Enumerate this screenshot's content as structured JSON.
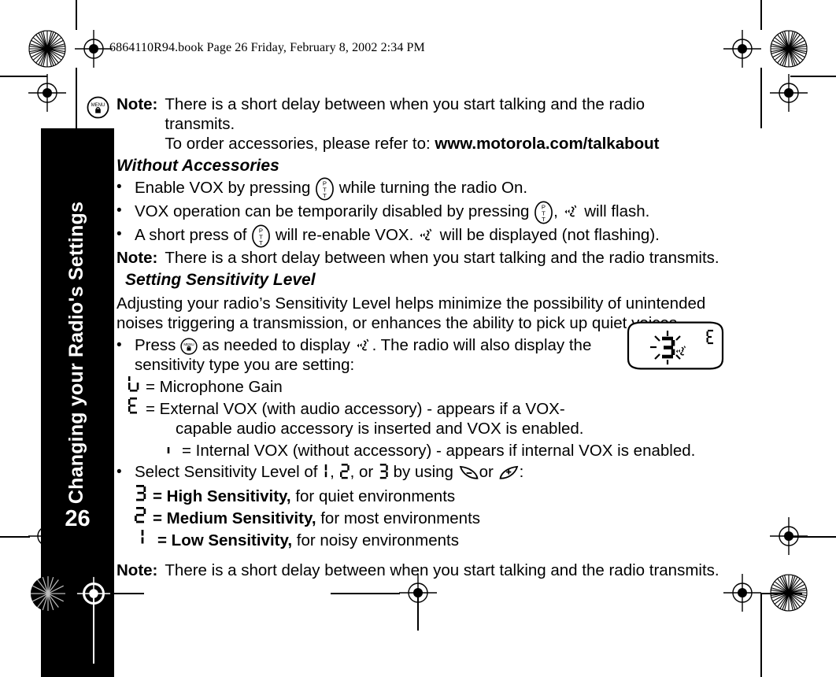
{
  "header": {
    "text": "6864110R94.book  Page 26  Friday, February 8, 2002  2:34 PM"
  },
  "sidebar": {
    "chapter_title": "Changing your Radio's Settings",
    "page_number": "26"
  },
  "content": {
    "note1": {
      "label": "Note:",
      "line1": "There is a short delay between when you start talking and the radio",
      "line2": "transmits.",
      "line3_prefix": "To order accessories, please refer to: ",
      "line3_url": "www.motorola.com/talkabout"
    },
    "heading_without_accessories": "Without Accessories",
    "bullets_without_accessories": [
      {
        "pre": "Enable VOX by pressing ",
        "icon": "ptt-icon",
        "post": " while turning the radio On."
      },
      {
        "pre": "VOX operation can be temporarily disabled by pressing ",
        "icon": "ptt-icon",
        "mid": ", ",
        "icon2": "vox-icon",
        "post": " will flash."
      },
      {
        "pre": "A short press of ",
        "icon": "ptt-icon",
        "mid": " will re-enable VOX. ",
        "icon2": "vox-icon",
        "post": " will be displayed (not flashing)."
      }
    ],
    "note2": {
      "label": "Note:",
      "text": "There is a short delay between when you start talking and the radio transmits."
    },
    "heading_setting_sensitivity": "Setting Sensitivity Level",
    "paragraph": {
      "line1": "Adjusting your radio’s Sensitivity Level helps minimize the possibility of unintended",
      "line2": "noises triggering a transmission, or enhances the ability to pick up quiet voices."
    },
    "press_bullet": {
      "pre": "Press ",
      "icon": "menu-icon",
      "mid": " as needed to display ",
      "icon2": "vox-icon",
      "post": ". The radio will also display the",
      "line2": "sensitivity type you are setting:"
    },
    "sensitivity_types": [
      {
        "glyph": "u",
        "text": "= Microphone Gain"
      },
      {
        "glyph": "E",
        "text": "= External VOX (with audio accessory) - appears if a VOX-",
        "cont": "capable audio accessory is inserted and VOX is enabled."
      },
      {
        "glyph": "i",
        "text": "= Internal VOX (without accessory) - appears if internal VOX is enabled."
      }
    ],
    "select_bullet": {
      "pre": "Select Sensitivity Level of ",
      "g1": "1",
      "sep1": ", ",
      "g2": "2",
      "sep2": ", or  ",
      "g3": "3",
      "mid": " by using ",
      "icon_minus": "minus-button-icon",
      "or": "or ",
      "icon_plus": "plus-button-icon",
      "post": ":"
    },
    "levels": [
      {
        "glyph": "3",
        "bold": "= High Sensitivity,",
        "rest": " for quiet environments"
      },
      {
        "glyph": "2",
        "bold": "= Medium Sensitivity,",
        "rest": " for most environments"
      },
      {
        "glyph": "1",
        "bold": "= Low Sensitivity,",
        "rest": " for noisy environments"
      }
    ],
    "note3": {
      "label": "Note:",
      "text": "There is a short delay between when you start talking and the radio transmits."
    }
  },
  "lcd_display": {
    "main_digit": "3",
    "corner_indicator": "E",
    "vox_icon": "vox-icon",
    "flashing": "true"
  },
  "colors": {
    "page_background": "#ffffff",
    "ink": "#000000",
    "sidebar_background": "#000000",
    "sidebar_text": "#ffffff"
  }
}
